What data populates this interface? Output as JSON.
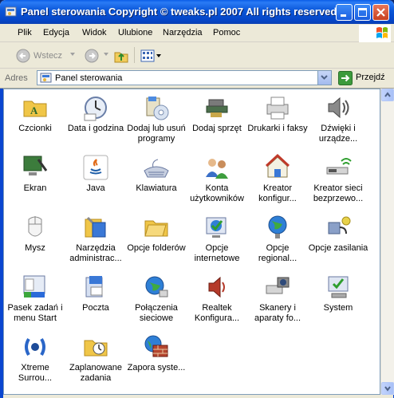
{
  "window": {
    "title": "Panel sterowania Copyright © tweaks.pl 2007 All rights reserved",
    "minimize_label": "",
    "maximize_label": "",
    "close_label": ""
  },
  "menu": [
    "Plik",
    "Edycja",
    "Widok",
    "Ulubione",
    "Narzędzia",
    "Pomoc"
  ],
  "toolbar": {
    "back_label": "Wstecz"
  },
  "address": {
    "label": "Adres",
    "value": "Panel sterowania",
    "go_label": "Przejdź"
  },
  "items": [
    {
      "label": "Czcionki",
      "icon": "fonts-folder-icon"
    },
    {
      "label": "Data i godzina",
      "icon": "clock-icon"
    },
    {
      "label": "Dodaj lub usuń programy",
      "icon": "add-remove-programs-icon"
    },
    {
      "label": "Dodaj sprzęt",
      "icon": "add-hardware-icon"
    },
    {
      "label": "Drukarki i faksy",
      "icon": "printer-icon"
    },
    {
      "label": "Dźwięki i urządze...",
      "icon": "speaker-icon"
    },
    {
      "label": "Ekran",
      "icon": "display-icon"
    },
    {
      "label": "Java",
      "icon": "java-icon"
    },
    {
      "label": "Klawiatura",
      "icon": "keyboard-icon"
    },
    {
      "label": "Konta użytkowników",
      "icon": "users-icon"
    },
    {
      "label": "Kreator konfigur...",
      "icon": "network-house-icon"
    },
    {
      "label": "Kreator sieci bezprzewo...",
      "icon": "wireless-icon"
    },
    {
      "label": "Mysz",
      "icon": "mouse-icon"
    },
    {
      "label": "Narzędzia administrac...",
      "icon": "admin-tools-icon"
    },
    {
      "label": "Opcje folderów",
      "icon": "folder-options-icon"
    },
    {
      "label": "Opcje internetowe",
      "icon": "internet-options-icon"
    },
    {
      "label": "Opcje regional...",
      "icon": "globe-icon"
    },
    {
      "label": "Opcje zasilania",
      "icon": "power-icon"
    },
    {
      "label": "Pasek zadań i menu Start",
      "icon": "taskbar-icon"
    },
    {
      "label": "Poczta",
      "icon": "mail-icon"
    },
    {
      "label": "Połączenia sieciowe",
      "icon": "network-connections-icon"
    },
    {
      "label": "Realtek Konfigura...",
      "icon": "realtek-speaker-icon"
    },
    {
      "label": "Skanery i aparaty fo...",
      "icon": "scanner-icon"
    },
    {
      "label": "System",
      "icon": "system-icon"
    },
    {
      "label": "Xtreme Surrou...",
      "icon": "surround-icon"
    },
    {
      "label": "Zaplanowane zadania",
      "icon": "scheduled-tasks-icon"
    },
    {
      "label": "Zapora syste...",
      "icon": "firewall-icon"
    }
  ]
}
